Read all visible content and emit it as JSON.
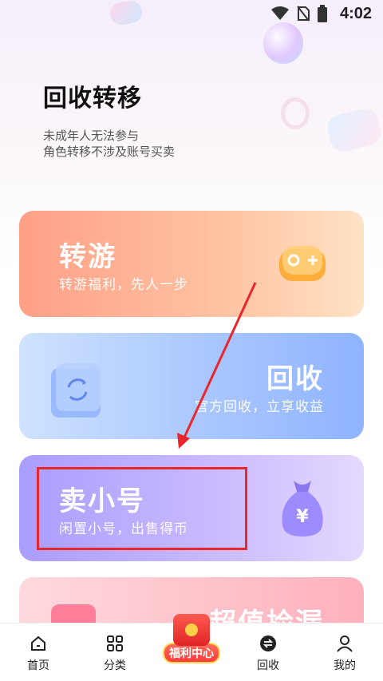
{
  "status_bar": {
    "time": "4:02",
    "icons": [
      "wifi-icon",
      "no-sim-icon",
      "battery-icon"
    ]
  },
  "header": {
    "title": "回收转移",
    "notice_line1": "未成年人无法参与",
    "notice_line2": "角色转移不涉及账号买卖"
  },
  "cards": {
    "transfer": {
      "title": "转游",
      "subtitle": "转游福利，先人一步",
      "icon": "gamepad-icon"
    },
    "recycle": {
      "title": "回收",
      "subtitle": "官方回收，立享收益",
      "icon": "recycle-bag-icon"
    },
    "sell": {
      "title": "卖小号",
      "subtitle": "闲置小号，出售得币",
      "icon": "money-bag-icon"
    },
    "bargain": {
      "title": "超值捡漏",
      "icon": "gift-icon"
    }
  },
  "bottom_nav": {
    "home": "首页",
    "category": "分类",
    "welfare": "福利中心",
    "recycle": "回收",
    "mine": "我的"
  },
  "colors": {
    "accent_red": "#e8262b"
  }
}
